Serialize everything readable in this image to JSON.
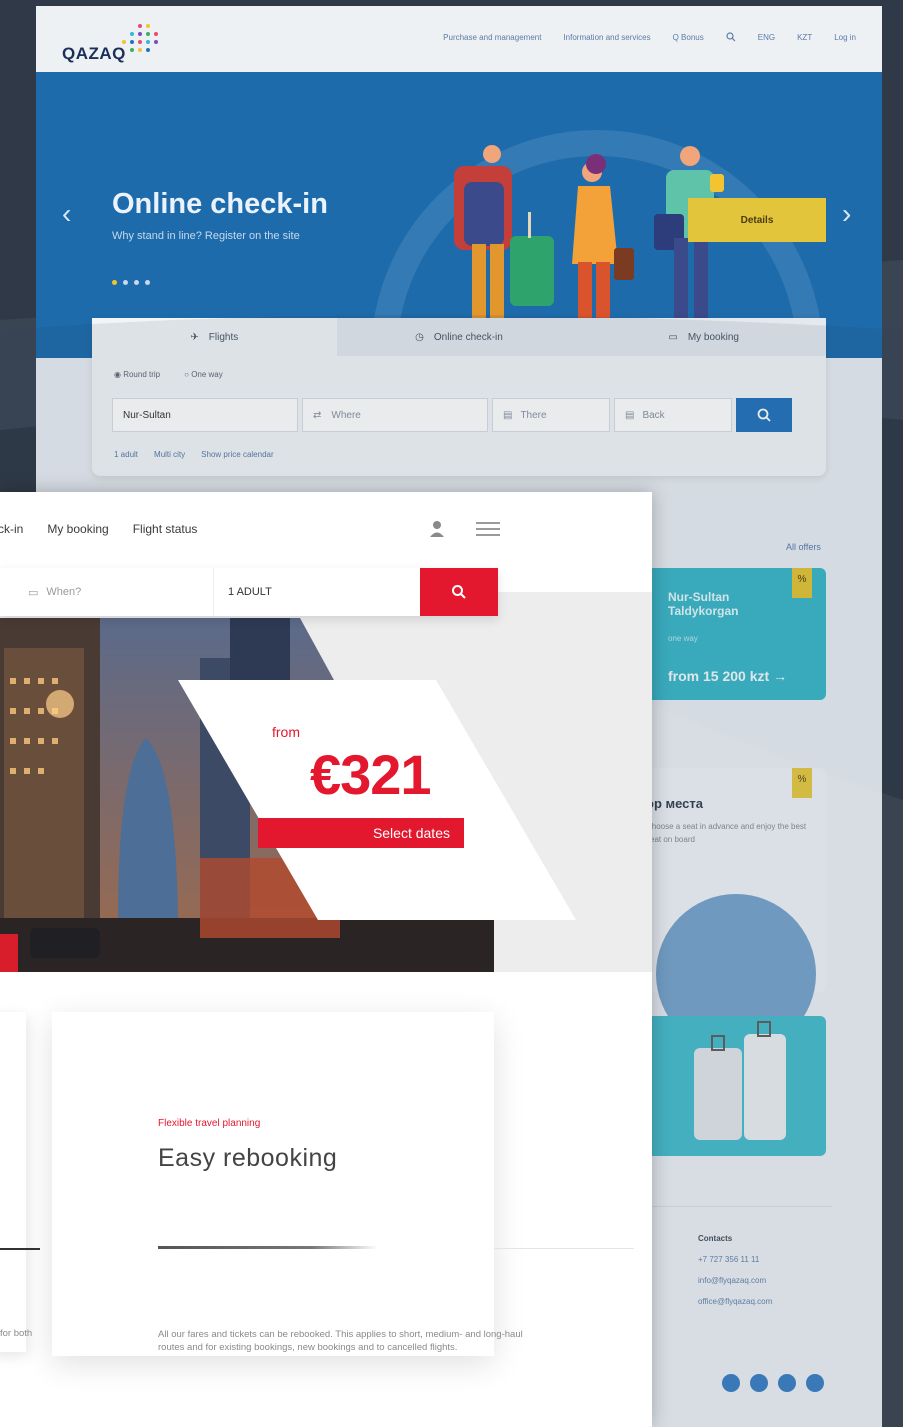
{
  "back": {
    "logo": "QAZAQ",
    "nav": [
      "Purchase and management",
      "Information and services",
      "Q Bonus",
      "ENG",
      "KZT",
      "Log in"
    ],
    "hero": {
      "title": "Online check-in",
      "subtitle": "Why stand in line? Register on the site",
      "details_button": "Details"
    },
    "search": {
      "tabs": [
        "Flights",
        "Online check-in",
        "My booking"
      ],
      "radios": [
        "Round trip",
        "One way"
      ],
      "from_value": "Nur-Sultan",
      "to_placeholder": "Where",
      "there_placeholder": "There",
      "back_placeholder": "Back",
      "options": [
        "1 adult",
        "Multi city",
        "Show price calendar"
      ]
    },
    "all_trips": "All offers",
    "offer_card": {
      "route_line1": "Nur-Sultan",
      "route_line2": "Taldykorgan",
      "route_sub": "one way",
      "price": "from 15 200 kzt"
    },
    "seat_card": {
      "title": "op места",
      "text": "Choose a seat in advance and enjoy the best seat on board"
    },
    "contacts": {
      "heading": "Contacts",
      "lines": [
        "+7 727 356 11 11",
        "info@flyqazaq.com",
        "office@flyqazaq.com"
      ]
    }
  },
  "front": {
    "nav": [
      "ck-in",
      "My booking",
      "Flight status"
    ],
    "search": {
      "when_placeholder": "When?",
      "adults": "1 ADULT"
    },
    "promo": {
      "from": "from",
      "price": "€321",
      "select_button": "Select dates"
    },
    "card": {
      "tag": "Flexible travel planning",
      "title": "Easy rebooking"
    },
    "description": "All our fares and tickets can be rebooked. This applies to short, medium- and long-haul routes and for existing bookings, new bookings and to cancelled flights.",
    "left_text": "for both"
  },
  "colors": {
    "accent_red": "#e3172d",
    "qazaq_blue": "#1e6bac",
    "qazaq_teal": "#3bb7c9",
    "qazaq_yellow": "#e3c53c"
  }
}
